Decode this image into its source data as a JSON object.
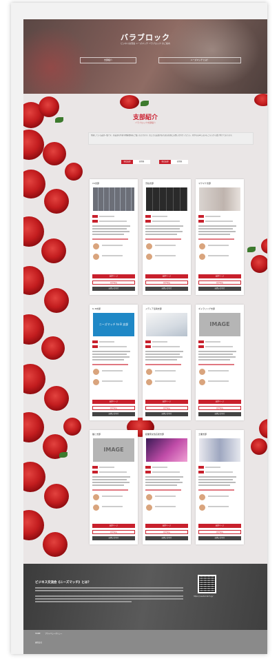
{
  "hero": {
    "title": "バラブロック",
    "subtitle": "ビジネス交流会 ニーズマッチ バラブロック のご案内",
    "buttons": [
      "支部紹介",
      "ニーズマッチとは？"
    ]
  },
  "section": {
    "title": "支部紹介",
    "subtitle": "バラブロック支部紹介",
    "intro": "所属している支部一覧です。各支部の特色や開催情報をご覧いただけます。気になる支部があればお気軽にお問い合わせください。見学のお申し込みもこちらから受け付けております。",
    "legend": [
      {
        "key": "昼会支部",
        "value": "昼開催"
      },
      {
        "key": "夜会支部",
        "value": "夜開催"
      }
    ]
  },
  "chapters": [
    {
      "name": "CS支部",
      "image": "photo-grid"
    },
    {
      "name": "渋谷支部",
      "image": "online-grid"
    },
    {
      "name": "マクマナ支部",
      "image": "office-photo"
    },
    {
      "name": "to B支部",
      "image": "banner",
      "banner_text": "ニーズマッチ to B 支部"
    },
    {
      "name": "メディア活用支部",
      "image": "chart-photo"
    },
    {
      "name": "ギャラリング支部",
      "image": "placeholder",
      "placeholder_text": "IMAGE"
    },
    {
      "name": "猫と支部",
      "image": "placeholder",
      "placeholder_text": "IMAGE"
    },
    {
      "name": "起業家女性応援支部",
      "image": "pink-photo"
    },
    {
      "name": "士業支部",
      "image": "business-photo"
    }
  ],
  "card_buttons": [
    "支部ページ",
    "見学申込",
    "お問い合わせ"
  ],
  "footer": {
    "title": "ビジネス交流会《ニーズマッチ》とは？",
    "url": "https://needsmatch.jp/"
  },
  "bottom": {
    "nav": [
      "HOME",
      "プライバシーポリシー"
    ],
    "company": "運営会社"
  },
  "colors": {
    "accent": "#c8202c",
    "rose": "#c31d1f",
    "footer": "#3b3b3b"
  }
}
